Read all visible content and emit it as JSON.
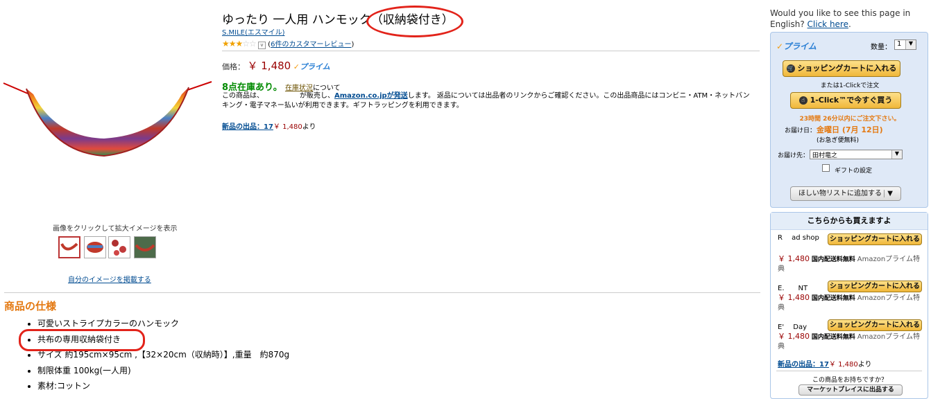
{
  "title": {
    "main": "ゆったり 一人用 ハンモック",
    "suffix": "（収納袋付き）"
  },
  "brand": "S.MILE(エスマイル)",
  "rating": {
    "stars": 2.5,
    "reviews_link": "6件のカスタマーレビュー"
  },
  "price": {
    "label": "価格：",
    "value": "￥ 1,480",
    "prime": "プライム"
  },
  "stock": {
    "text": "8点在庫あり。",
    "status_link": "在庫状況",
    "status_suffix": "について"
  },
  "sold_by": {
    "prefix": "この商品は、",
    "seller": "",
    "mid": "が販売し、",
    "amazon": "Amazon.co.jp",
    "ships": "が発送",
    "rest": "します。 返品については出品者のリンクからご確認ください。この出品商品にはコンビニ・ATM・ネットバンキング・電子マネー払いが利用できます。ギフトラッピングを利用できます。"
  },
  "new_offers": {
    "label": "新品の出品：17",
    "price": "￥ 1,480",
    "suffix": "より"
  },
  "image_area": {
    "caption": "画像をクリックして拡大イメージを表示",
    "own_image_link": "自分のイメージを掲載する"
  },
  "specs": {
    "title": "商品の仕様",
    "items": [
      "可愛いストライプカラーのハンモック",
      "共布の専用収納袋付き",
      "サイズ 約195cm×95cm ,【32×20cm（収納時）】,重量　約870g",
      "制限体重 100kg(一人用)",
      "素材:コットン"
    ]
  },
  "english_prompt": {
    "text": "Would you like to see this page in English?",
    "link": "Click here"
  },
  "buybox": {
    "prime": "プライム",
    "qty_label": "数量：",
    "qty_value": "1",
    "cart_button": "ショッピングカートに入れる",
    "or_text": "または1-Clickで注文",
    "oneclick_button": "1-Click™で今すぐ買う",
    "order_within": "23時間 26分以内にご注文下さい。",
    "delivery_label": "お届け日：",
    "delivery_date": "金曜日 (7月 12日)",
    "delivery_note": "(お急ぎ便無料)",
    "ship_to_label": "お届け先：",
    "ship_to_value": "田村竜之",
    "gift_label": "ギフトの設定",
    "wishlist_button": "ほしい物リストに追加する"
  },
  "other_sellers": {
    "header": "こちらからも買えますよ",
    "offers": [
      {
        "seller": "R　 ad shop",
        "price": "￥ 1,480",
        "shipping": "国内配送料無料",
        "prime": "Amazonプライム特典",
        "button": "ショッピングカートに入れる"
      },
      {
        "seller": "E.　　NT",
        "price": "￥ 1,480",
        "shipping": "国内配送料無料",
        "prime": "Amazonプライム特典",
        "button": "ショッピングカートに入れる"
      },
      {
        "seller": "E'　 Day",
        "price": "￥ 1,480",
        "shipping": "国内配送料無料",
        "prime": "Amazonプライム特典",
        "button": "ショッピングカートに入れる"
      }
    ],
    "new_offers": {
      "label": "新品の出品：17",
      "price": "￥ 1,480",
      "suffix": "より"
    },
    "have_one": "この商品をお持ちですか？",
    "sell_button": "マーケットプレイスに出品する"
  }
}
